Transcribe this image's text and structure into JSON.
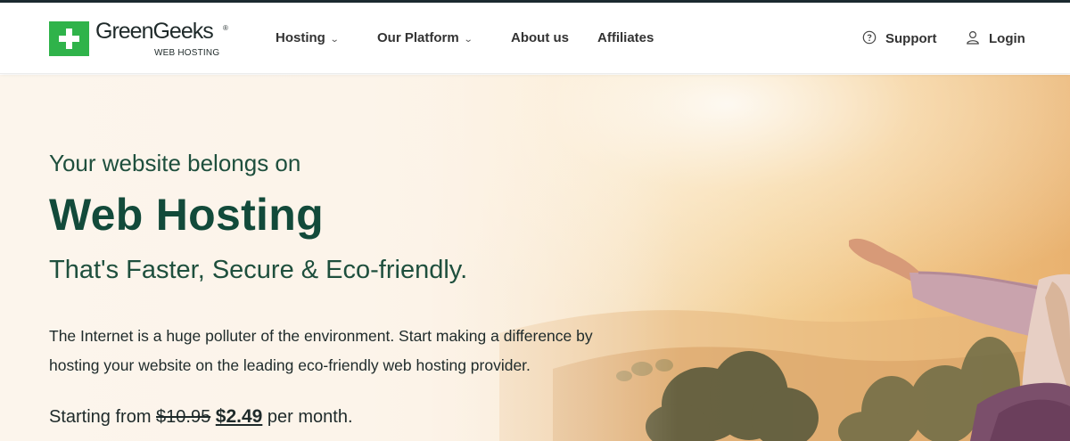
{
  "brand": {
    "name": "GreenGeeks",
    "registered": "®",
    "tagline": "WEB HOSTING",
    "accent_color": "#2fb34a",
    "logo_icon": "plus-icon"
  },
  "nav": {
    "items": [
      {
        "label": "Hosting",
        "has_dropdown": true
      },
      {
        "label": "Our Platform",
        "has_dropdown": true
      },
      {
        "label": "About us",
        "has_dropdown": false
      },
      {
        "label": "Affiliates",
        "has_dropdown": false
      }
    ],
    "dropdown_icon": "chevron-down-icon",
    "support": {
      "label": "Support",
      "icon": "question-circle-icon"
    },
    "login": {
      "label": "Login",
      "icon": "user-icon"
    }
  },
  "hero": {
    "pre_title": "Your website belongs on",
    "title": "Web Hosting",
    "subtitle": "That's Faster, Secure & Eco-friendly.",
    "description": "The Internet is a huge polluter of the environment. Start making a difference by hosting your website on the leading eco-friendly web hosting provider.",
    "price_prefix": "Starting from",
    "price_old": "$10.95",
    "price_new": "$2.49",
    "price_suffix": "per month.",
    "heading_color": "#124a3a"
  }
}
